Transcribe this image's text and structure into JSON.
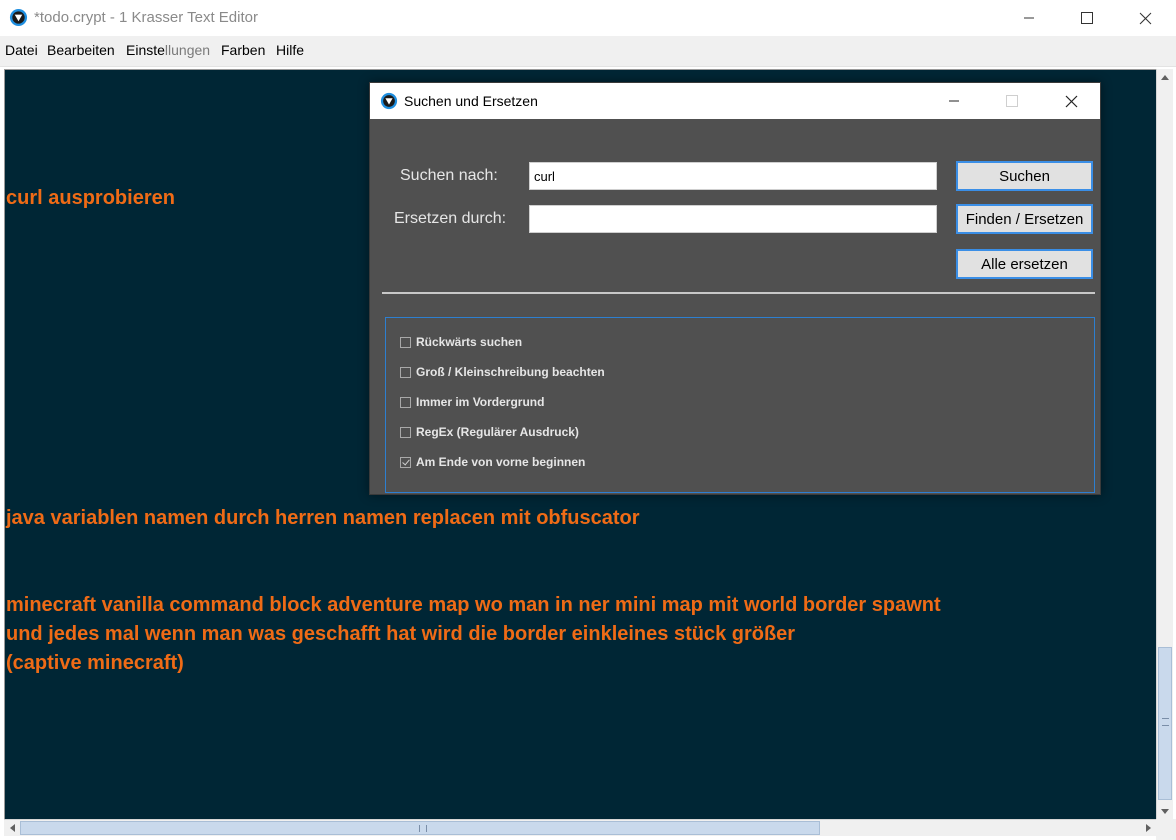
{
  "window": {
    "title": "*todo.crypt - 1 Krasser Text Editor"
  },
  "menu": {
    "items": [
      "Datei",
      "Bearbeiten",
      "Einstellungen",
      "Farben",
      "Hilfe"
    ],
    "einstellungen_parts": [
      "Einste",
      "llungen"
    ]
  },
  "editor": {
    "lines": [
      "curl ausprobieren",
      "java variablen namen durch herren namen replacen mit obfuscator",
      "minecraft  vanilla command block adventure map wo man  in ner mini map  mit world border spawnt",
      "und  jedes  mal wenn  man was  geschafft hat wird die border  einkleines stück größer",
      "(captive minecraft)"
    ],
    "text_color": "#ef6b16",
    "background_color": "#002635"
  },
  "dialog": {
    "title": "Suchen und Ersetzen",
    "search_label": "Suchen nach:",
    "search_value": "curl",
    "replace_label": "Ersetzen durch:",
    "replace_value": "",
    "buttons": {
      "search": "Suchen",
      "find_replace": "Finden / Ersetzen",
      "replace_all": "Alle ersetzen"
    },
    "options": [
      {
        "label": "Rückwärts suchen",
        "checked": false
      },
      {
        "label": "Groß / Kleinschreibung beachten",
        "checked": false
      },
      {
        "label": "Immer im Vordergrund",
        "checked": false
      },
      {
        "label": "RegEx (Regulärer Ausdruck)",
        "checked": false
      },
      {
        "label": "Am Ende von vorne beginnen",
        "checked": true
      }
    ]
  }
}
